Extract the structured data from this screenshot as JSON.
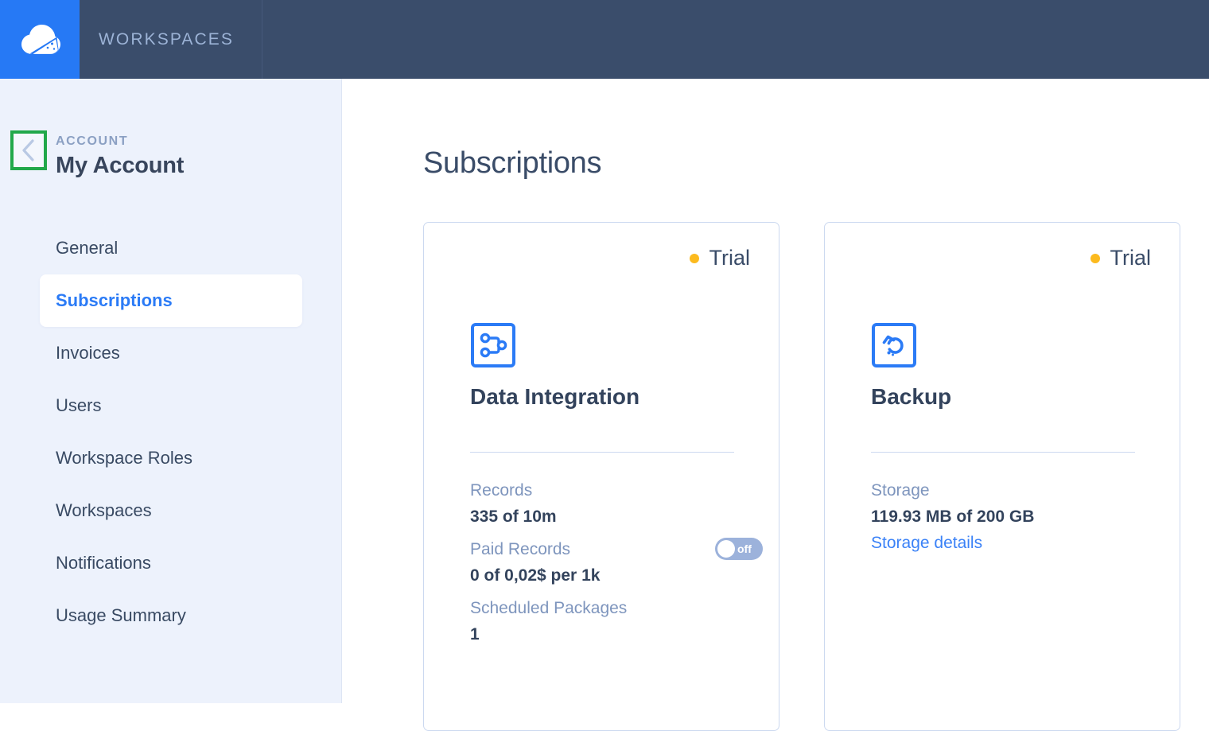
{
  "topbar": {
    "logo_icon": "cloud-logo-icon",
    "brand": "WORKSPACES"
  },
  "sidebar": {
    "back_icon": "chevron-left-icon",
    "section_label": "ACCOUNT",
    "title": "My Account",
    "items": [
      {
        "label": "General",
        "active": false
      },
      {
        "label": "Subscriptions",
        "active": true
      },
      {
        "label": "Invoices",
        "active": false
      },
      {
        "label": "Users",
        "active": false
      },
      {
        "label": "Workspace Roles",
        "active": false
      },
      {
        "label": "Workspaces",
        "active": false
      },
      {
        "label": "Notifications",
        "active": false
      },
      {
        "label": "Usage Summary",
        "active": false
      }
    ]
  },
  "main": {
    "page_title": "Subscriptions",
    "cards": [
      {
        "status": "Trial",
        "icon": "data-integration-icon",
        "name": "Data Integration",
        "metrics": [
          {
            "label": "Records",
            "value": "335 of 10m"
          },
          {
            "label": "Paid Records",
            "value": "0 of 0,02$ per 1k",
            "toggle": "off"
          },
          {
            "label": "Scheduled Packages",
            "value": "1"
          }
        ]
      },
      {
        "status": "Trial",
        "icon": "backup-restore-icon",
        "name": "Backup",
        "metrics": [
          {
            "label": "Storage",
            "value": "119.93 MB of 200 GB",
            "link": "Storage details"
          }
        ]
      }
    ]
  },
  "colors": {
    "topbar": "#3a4d6b",
    "logo_tile": "#2679f5",
    "sidebar_bg": "#edf2fc",
    "accent_blue": "#2b7bf6",
    "status_amber": "#fcba1e",
    "annotation_green": "#22a84a",
    "toggle_track": "#9cb2db"
  }
}
